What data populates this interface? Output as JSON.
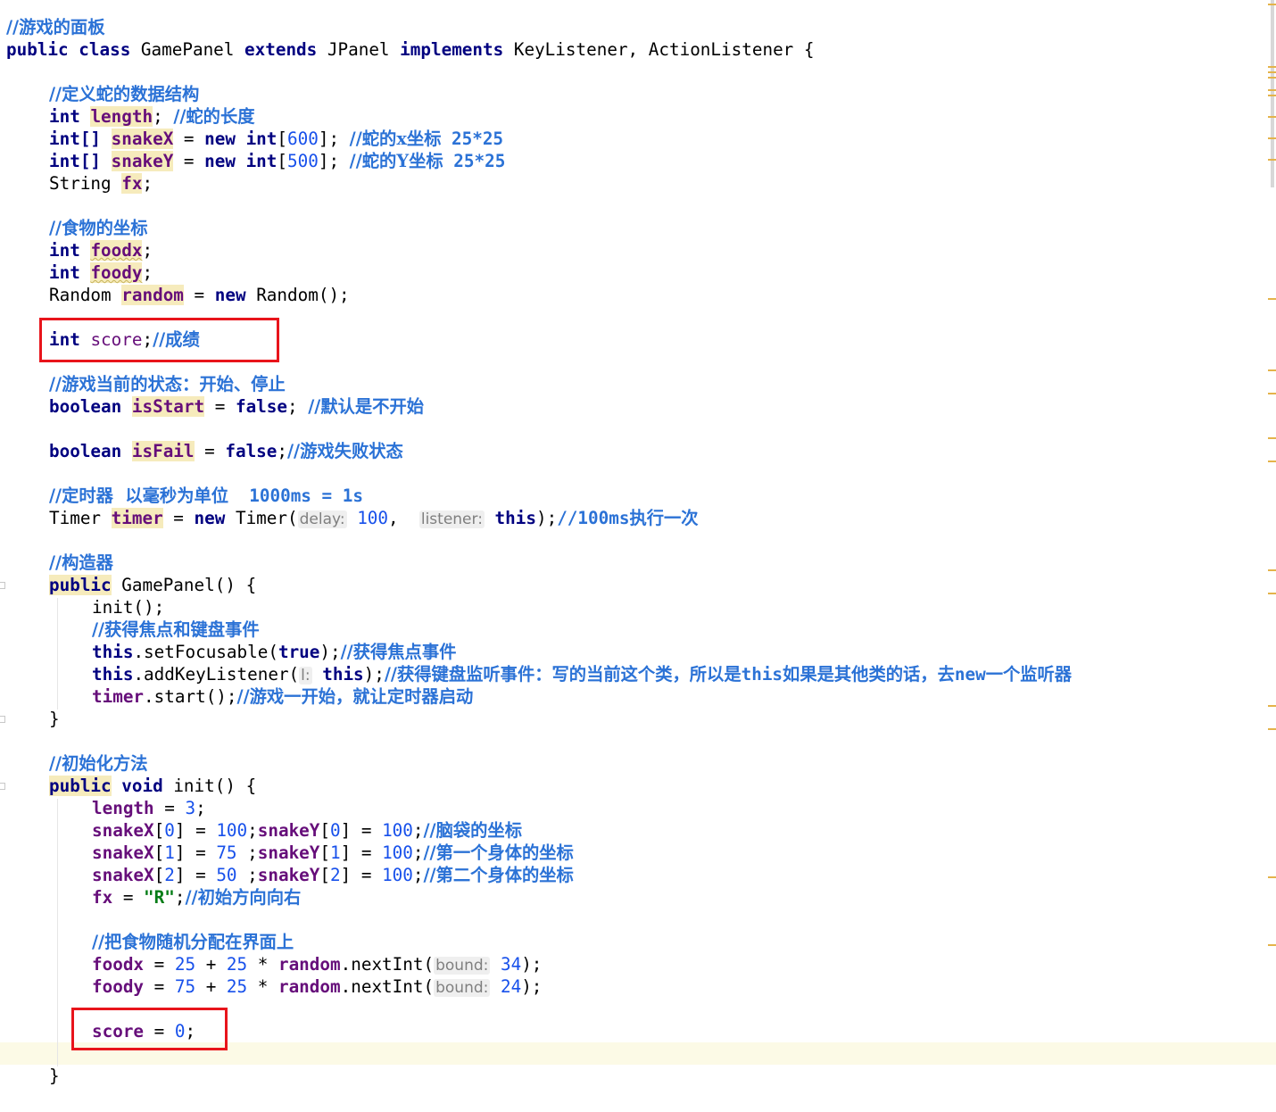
{
  "code": {
    "l1": "//游戏的面板",
    "l2_public": "public",
    "l2_class": "class",
    "l2_name": "GamePanel",
    "l2_extends": "extends",
    "l2_super": "JPanel",
    "l2_implements": "implements",
    "l2_ifaces": "KeyListener, ActionListener {",
    "c_struct": "//定义蛇的数据结构",
    "int": "int",
    "int_arr": "int[]",
    "v_length": "length",
    "c_length": "//蛇的长度",
    "v_snakeX": "snakeX",
    "v_snakeY": "snakeY",
    "new": "new",
    "n600": "600",
    "n500": "500",
    "c_snakeX": "//蛇的x坐标",
    "c_snakeY": "//蛇的Y坐标",
    "c_25": "25*25",
    "t_string": "String",
    "v_fx": "fx",
    "c_food": "//食物的坐标",
    "v_foodx": "foodx",
    "v_foody": "foody",
    "t_random": "Random",
    "v_random": "random",
    "new_random": "Random();",
    "v_score": "score",
    "c_score": "//成绩",
    "c_state": "//游戏当前的状态：开始、停止",
    "boolean": "boolean",
    "v_isStart": "isStart",
    "false": "false",
    "c_default": "//默认是不开始",
    "v_isFail": "isFail",
    "c_fail": "//游戏失败状态",
    "c_timer_a": "//定时器  以毫秒为单位",
    "c_timer_b": "1000ms = 1s",
    "t_timer": "Timer",
    "v_timer": "timer",
    "new_timer": "Timer(",
    "hint_delay": "delay:",
    "n100": "100",
    "hint_listener": "listener:",
    "this": "this",
    "c_100ms_a": "//100ms",
    "c_100ms_b": "执行一次",
    "c_ctor": "//构造器",
    "ctor_name": "GamePanel() {",
    "init_call": "init();",
    "c_focus_key": "//获得焦点和键盘事件",
    "setFocusable": ".setFocusable(",
    "true": "true",
    "c_focus": "//获得焦点事件",
    "addKeyListener": ".addKeyListener(",
    "hint_l": "l:",
    "c_key_a": "//获得键盘监听事件：写的当前这个类，所以是",
    "c_key_this": "this",
    "c_key_b": "如果是其他类的话，去",
    "c_key_new": "new",
    "c_key_c": "一个监听器",
    "timer_start": ".start();",
    "c_timer_start": "//游戏一开始，就让定时器启动",
    "close_brace": "}",
    "c_init": "//初始化方法",
    "void": "void",
    "init_decl": "init() {",
    "n3": "3",
    "idx0": "0",
    "idx1": "1",
    "idx2": "2",
    "n75": "75",
    "n50": "50",
    "n25": "25",
    "c_head": "//脑袋的坐标",
    "c_body1": "//第一个身体的坐标",
    "c_body2": "//第二个身体的坐标",
    "str_R": "\"R\"",
    "c_dir": "//初始方向向右",
    "c_foodrand": "//把食物随机分配在界面上",
    "nextInt": ".nextInt(",
    "hint_bound": "bound:",
    "n34": "34",
    "n24": "24",
    "n0": "0"
  },
  "colors": {
    "keyword": "#000080",
    "comment": "#2b72d6",
    "number": "#1750eb",
    "field": "#660e7a",
    "highlight_bg": "#f6ebbc",
    "red_box": "#e8141b",
    "current_line": "#fcfae6"
  }
}
